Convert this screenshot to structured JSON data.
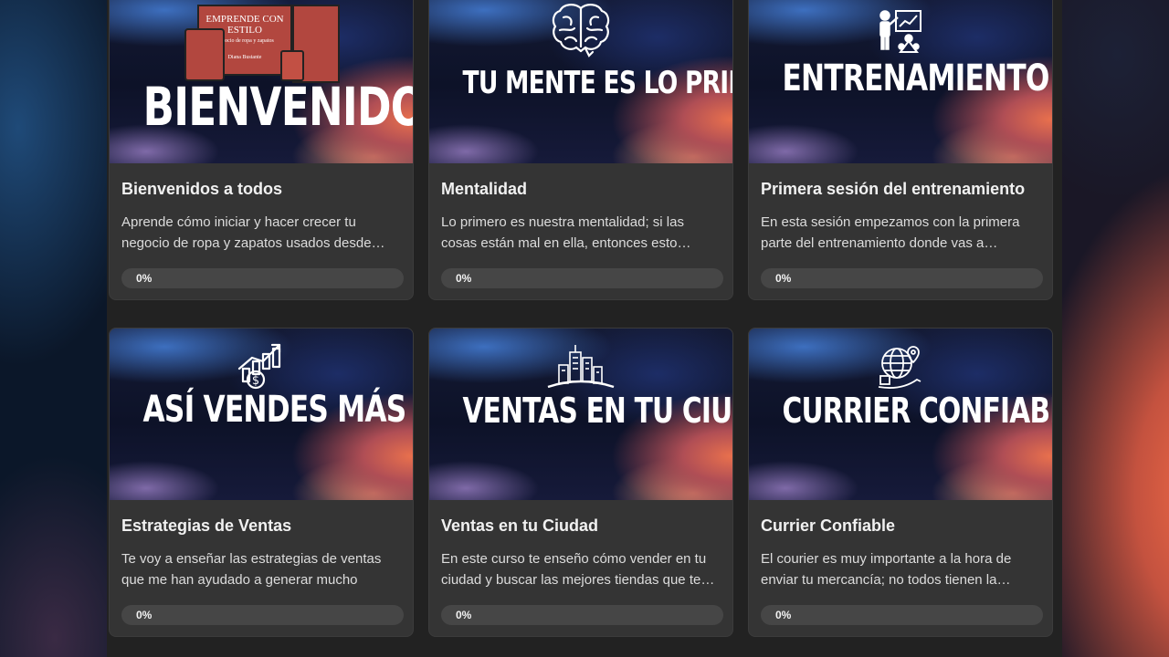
{
  "cards": [
    {
      "thumb_title": "BIENVENIDOS",
      "icon": "book-mockup-image",
      "book_title": "EMPRENDE CON ESTILO",
      "book_subtitle": "Negocio de ropa y zapatos",
      "book_author": "Diana Bustante",
      "title": "Bienvenidos a todos",
      "description": "Aprende cómo iniciar y hacer crecer tu negocio de ropa y zapatos usados desde…",
      "progress_label": "0%",
      "progress": 0
    },
    {
      "thumb_title": "TU MENTE ES LO PRIMERO",
      "icon": "brain-icon",
      "title": "Mentalidad",
      "description": "Lo primero es nuestra mentalidad; si las cosas están mal en ella, entonces esto…",
      "progress_label": "0%",
      "progress": 0
    },
    {
      "thumb_title": "ENTRENAMIENTO",
      "icon": "presentation-icon",
      "title": "Primera sesión del entrenamiento",
      "description": "En esta sesión empezamos con la primera parte del entrenamiento donde vas a…",
      "progress_label": "0%",
      "progress": 0
    },
    {
      "thumb_title": "ASÍ VENDES MÁS",
      "icon": "sales-growth-icon",
      "title": "Estrategias de Ventas",
      "description": "Te voy a enseñar las estrategias de ventas que me han ayudado a generar mucho diner…",
      "progress_label": "0%",
      "progress": 0
    },
    {
      "thumb_title": "VENTAS EN TU CIUDAD",
      "icon": "city-buildings-icon",
      "title": "Ventas en tu Ciudad",
      "description": "En este curso te enseño cómo vender en tu ciudad y buscar las mejores tiendas que te…",
      "progress_label": "0%",
      "progress": 0
    },
    {
      "thumb_title": "CURRIER CONFIABLE",
      "icon": "globe-delivery-icon",
      "title": "Currier Confiable",
      "description": "El courier es muy importante a la hora de enviar tu mercancía; no todos tienen la…",
      "progress_label": "0%",
      "progress": 0
    }
  ]
}
